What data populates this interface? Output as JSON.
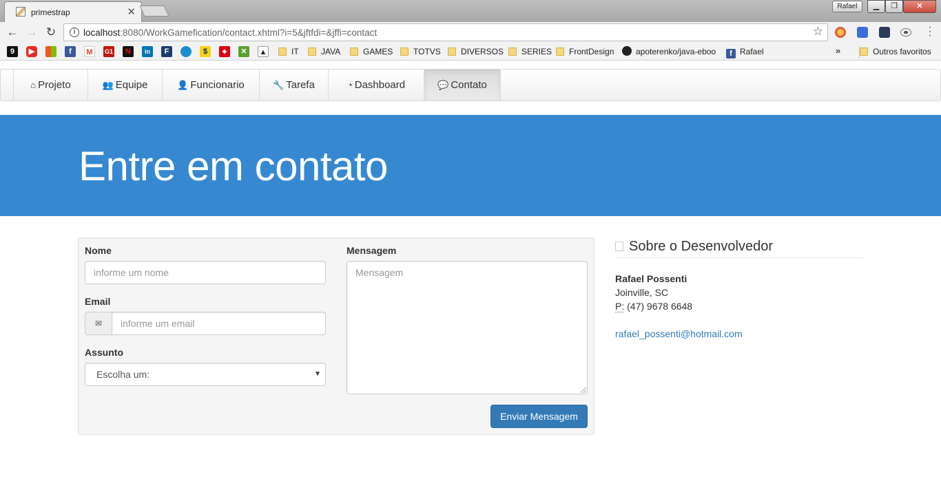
{
  "browser": {
    "tab_title": "primestrap",
    "window_user": "Rafael",
    "url_host": "localhost",
    "url_rest": ":8080/WorkGamefication/contact.xhtml?i=5&jftfdi=&jffi=contact",
    "bookmarks": {
      "folders": [
        "IT",
        "JAVA",
        "GAMES",
        "TOTVS",
        "DIVERSOS",
        "SERIES",
        "FrontDesign"
      ],
      "github_label": "apoterenko/java-eboo",
      "facebook_label": "Rafael",
      "other_favorites": "Outros favoritos"
    }
  },
  "nav": {
    "items": [
      {
        "label": "Projeto",
        "icon": "home-icon"
      },
      {
        "label": "Equipe",
        "icon": "users-icon"
      },
      {
        "label": "Funcionario",
        "icon": "user-icon"
      },
      {
        "label": "Tarefa",
        "icon": "wrench-icon"
      },
      {
        "label": "Dashboard",
        "icon": "pie-chart-icon"
      },
      {
        "label": "Contato",
        "icon": "chat-icon"
      }
    ],
    "active": "Contato"
  },
  "hero": {
    "title": "Entre em contato"
  },
  "form": {
    "name_label": "Nome",
    "name_placeholder": "informe um nome",
    "email_label": "Email",
    "email_placeholder": "informe um email",
    "subject_label": "Assunto",
    "subject_value": "Escolha um:",
    "message_label": "Mensagem",
    "message_placeholder": "Mensagem",
    "submit_label": "Enviar Mensagem"
  },
  "sidebar": {
    "heading": "Sobre o Desenvolvedor",
    "name": "Rafael Possenti",
    "city": "Joinville, SC",
    "phone_prefix": "P:",
    "phone": "(47) 9678 6648",
    "email": "rafael_possenti@hotmail.com"
  },
  "colors": {
    "hero_bg": "#3689d0",
    "primary": "#337ab7"
  }
}
